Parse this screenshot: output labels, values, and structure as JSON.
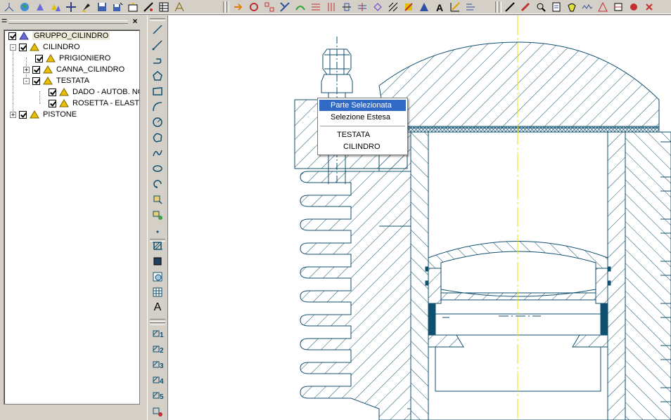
{
  "toolbar": {
    "icons": [
      "axis-icon",
      "globe-icon",
      "part-icon",
      "assembly-icon",
      "move-icon",
      "paint-icon",
      "save-icon",
      "save-as-icon",
      "export-icon",
      "measure-icon",
      "table-icon",
      "dimension-icon",
      "cut-icon",
      "rotate-icon",
      "array-icon",
      "trim-icon",
      "extend-icon",
      "grid-icon",
      "align-icon",
      "explode-icon",
      "offset-icon",
      "mirror-icon",
      "hatch-icon",
      "text-icon",
      "annotation-icon",
      "pencil-icon",
      "fill-icon",
      "zoom-icon",
      "print-icon",
      "light-icon",
      "wave-icon",
      "render-icon",
      "copy-icon",
      "tools-icon"
    ]
  },
  "tree_panel": {
    "minimize_glyph": "=",
    "close_glyph": "×",
    "items": [
      {
        "label": "GRUPPO_CILINDRO",
        "expander": "",
        "icon_color": "#5a5ad0"
      },
      {
        "label": "CILINDRO",
        "expander": "-",
        "icon_color": "#e8c000"
      },
      {
        "label": "PRIGIONIERO",
        "expander": "",
        "icon_color": "#e8c000"
      },
      {
        "label": "CANNA_CILINDRO",
        "expander": "+",
        "icon_color": "#e8c000"
      },
      {
        "label": "TESTATA",
        "expander": "-",
        "icon_color": "#e8c000"
      },
      {
        "label": "DADO - AUTOB. NO",
        "expander": "",
        "icon_color": "#e8c000"
      },
      {
        "label": "ROSETTA - ELASTIC",
        "expander": "",
        "icon_color": "#e8c000"
      },
      {
        "label": "PISTONE",
        "expander": "+",
        "icon_color": "#e8c000"
      }
    ]
  },
  "vertical_toolbar": {
    "icons": [
      "line-icon",
      "polyline-icon",
      "curve-icon",
      "polygon-icon",
      "rectangle-icon",
      "arc-icon",
      "circle-icon",
      "cloud-icon",
      "spline-icon",
      "ellipse-icon",
      "rotate-icon",
      "block-insert-icon",
      "block-edit-icon",
      "point-icon",
      "hatch-area-icon",
      "solid-fill-icon",
      "image-icon",
      "table-icon",
      "text-icon"
    ],
    "text_tool_glyph": "A",
    "view_buttons": [
      "1",
      "2",
      "3",
      "4",
      "5"
    ]
  },
  "context_menu": {
    "items": [
      "Parte Selezionata",
      "Selezione Estesa",
      "TESTATA",
      "CILINDRO"
    ],
    "highlighted": "Parte Selezionata"
  },
  "colors": {
    "drawing_line": "#0f4f6f",
    "center_line": "#e6e600",
    "menu_highlight": "#316ac5",
    "chrome": "#d4d0c8"
  }
}
